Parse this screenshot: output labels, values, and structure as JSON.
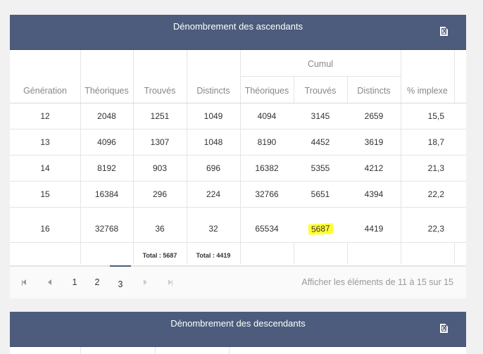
{
  "ascendants": {
    "title": "Dénombrement des ascendants",
    "export_icon": "excel-export-icon",
    "headers": {
      "group_cumul": "Cumul",
      "generation": "Génération",
      "theoriques": "Théoriques",
      "trouves": "Trouvés",
      "distincts": "Distincts",
      "cumul_theoriques": "Théoriques",
      "cumul_trouves": "Trouvés",
      "cumul_distincts": "Distincts",
      "implexe": "% implexe"
    },
    "rows": [
      [
        "12",
        "2048",
        "1251",
        "1049",
        "4094",
        "3145",
        "2659",
        "15,5"
      ],
      [
        "13",
        "4096",
        "1307",
        "1048",
        "8190",
        "4452",
        "3619",
        "18,7"
      ],
      [
        "14",
        "8192",
        "903",
        "696",
        "16382",
        "5355",
        "4212",
        "21,3"
      ],
      [
        "15",
        "16384",
        "296",
        "224",
        "32766",
        "5651",
        "4394",
        "22,2"
      ],
      [
        "16",
        "32768",
        "36",
        "32",
        "65534",
        "5687",
        "4419",
        "22,3"
      ]
    ],
    "totals": {
      "trouves": "Total : 5687",
      "distincts": "Total : 4419"
    },
    "pager": {
      "pages": [
        "1",
        "2",
        "3"
      ],
      "current": "3",
      "info": "Afficher les éléments de 11 à 15 sur 15"
    },
    "highlight_color": "#ffff33"
  },
  "descendants": {
    "title": "Dénombrement des descendants",
    "export_icon": "excel-export-icon"
  },
  "colors": {
    "header_bg": "#4d5b7c",
    "grid_line": "#e4e4e4"
  }
}
